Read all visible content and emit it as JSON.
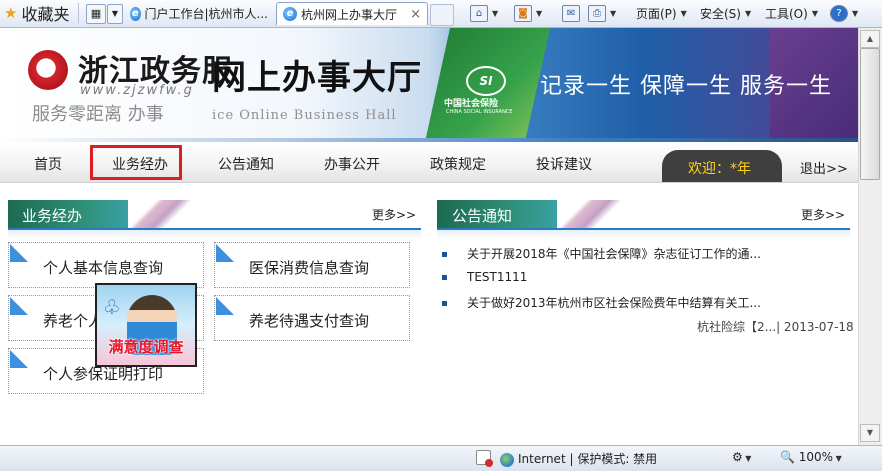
{
  "browser": {
    "favorites_label": "收藏夹",
    "tabs": [
      {
        "title": "门户工作台|杭州市人..."
      },
      {
        "title": "杭州网上办事大厅",
        "close": "×"
      }
    ],
    "toolbar": {
      "page_menu": "页面(P)",
      "safety_menu": "安全(S)",
      "tools_menu": "工具(O)"
    },
    "status": {
      "zone": "Internet | 保护模式: 禁用",
      "zoom": "100%"
    }
  },
  "header": {
    "logo_text": "浙江政务服",
    "logo_url": "www.zjzwfw.g",
    "slogan": "服务零距离  办事",
    "hall_title": "网上办事大厅",
    "hall_title_en": "ice Online Business Hall",
    "si_mark": "SI",
    "si_cn": "中国社会保险",
    "si_en": "CHINA SOCIAL INSURANCE",
    "motto": "记录一生  保障一生  服务一生"
  },
  "nav": {
    "items": [
      "首页",
      "业务经办",
      "公告通知",
      "办事公开",
      "政策规定",
      "投诉建议"
    ],
    "active_index": 1,
    "welcome": "欢迎：*年",
    "logout": "退出>>"
  },
  "business_panel": {
    "title": "业务经办",
    "more": "更多>>",
    "cards": [
      "个人基本信息查询",
      "医保消费信息查询",
      "养老个人",
      "养老待遇支付查询",
      "个人参保证明打印"
    ]
  },
  "survey_popup": {
    "text": "满意度调查"
  },
  "notice_panel": {
    "title": "公告通知",
    "more": "更多>>",
    "items": [
      "关于开展2018年《中国社会保障》杂志征订工作的通...",
      "TEST1111",
      "关于做好2013年杭州市区社会保险费年中结算有关工..."
    ],
    "meta": "杭社险综【2...| 2013-07-18"
  }
}
